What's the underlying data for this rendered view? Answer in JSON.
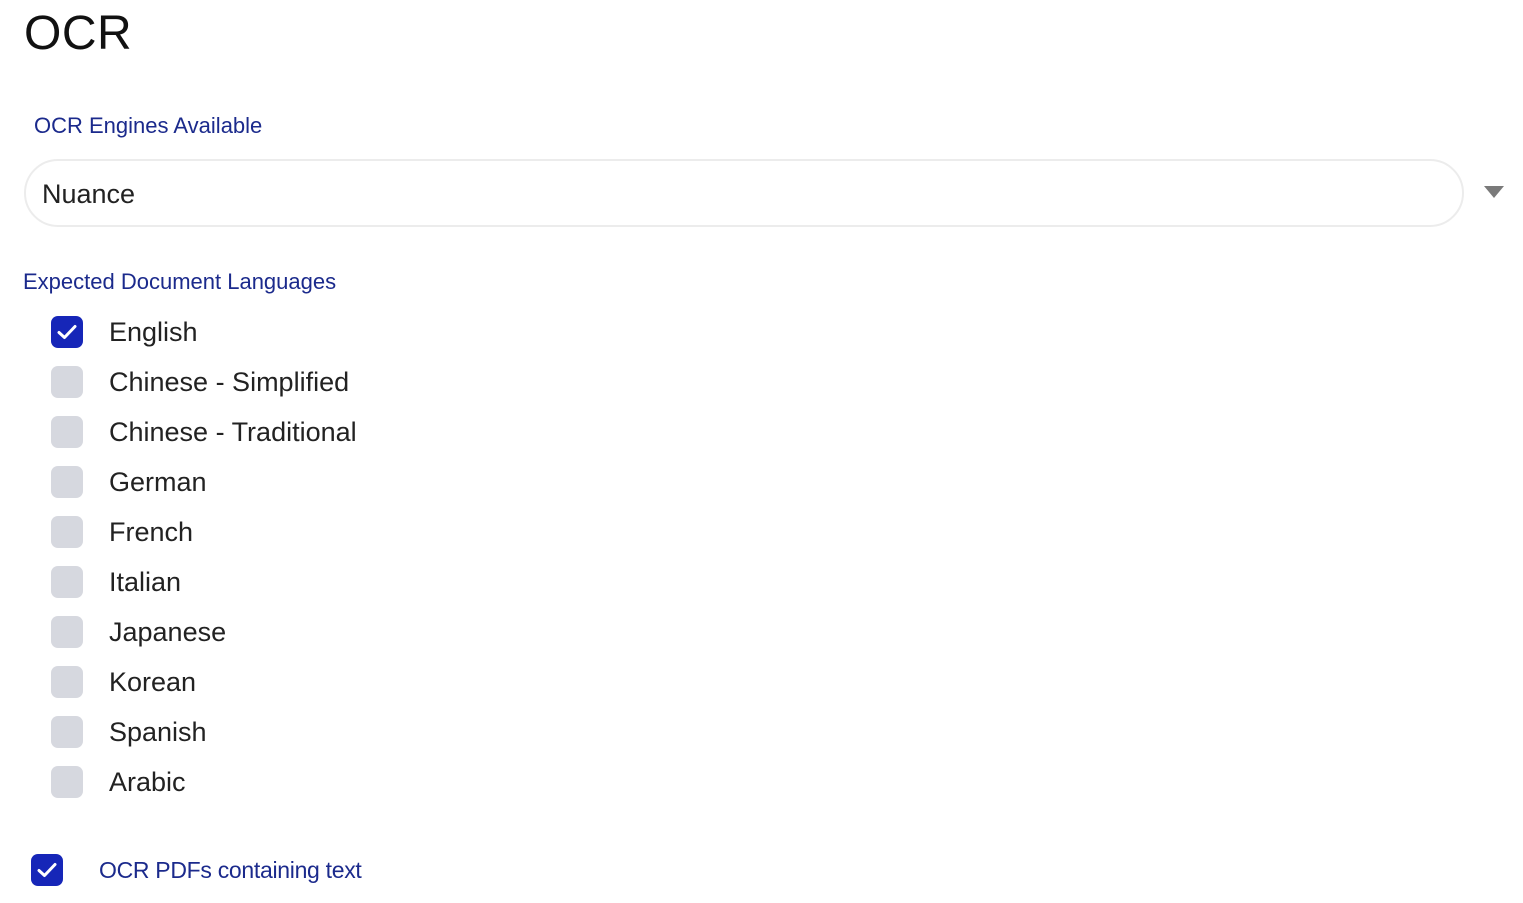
{
  "page": {
    "title": "OCR"
  },
  "engine": {
    "label": "OCR Engines Available",
    "selected": "Nuance"
  },
  "languages": {
    "label": "Expected Document Languages",
    "items": [
      {
        "label": "English",
        "checked": true
      },
      {
        "label": "Chinese - Simplified",
        "checked": false
      },
      {
        "label": "Chinese - Traditional",
        "checked": false
      },
      {
        "label": "German",
        "checked": false
      },
      {
        "label": "French",
        "checked": false
      },
      {
        "label": "Italian",
        "checked": false
      },
      {
        "label": "Japanese",
        "checked": false
      },
      {
        "label": "Korean",
        "checked": false
      },
      {
        "label": "Spanish",
        "checked": false
      },
      {
        "label": "Arabic",
        "checked": false
      }
    ]
  },
  "ocr_pdfs": {
    "label": "OCR PDFs containing text",
    "checked": true
  },
  "colors": {
    "accent": "#1626b8",
    "label_text": "#1b2a8c",
    "unchecked_box": "#d6d8df"
  },
  "icons": {
    "checkbox_check": "checkmark-icon",
    "select_caret": "caret-down-icon"
  }
}
